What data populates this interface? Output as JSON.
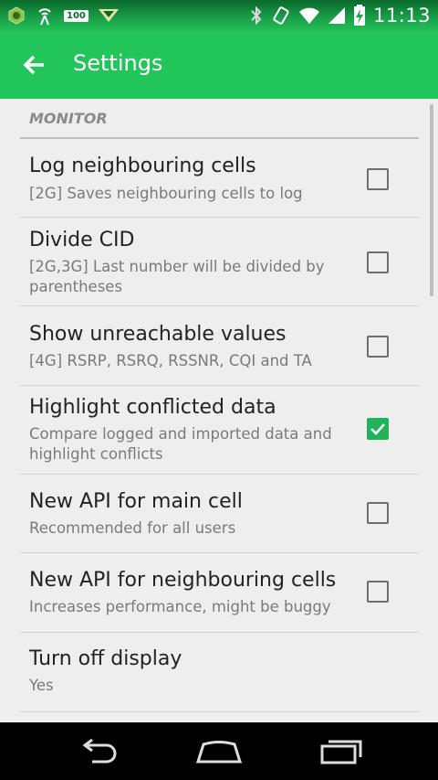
{
  "status_bar": {
    "battery_badge": "100",
    "time": "11:13"
  },
  "action_bar": {
    "title": "Settings"
  },
  "category": {
    "label": "MONITOR"
  },
  "preferences": [
    {
      "title": "Log neighbouring cells",
      "summary": "[2G] Saves neighbouring cells to log",
      "checked": false
    },
    {
      "title": "Divide CID",
      "summary": "[2G,3G] Last number will be divided by parentheses",
      "checked": false
    },
    {
      "title": "Show unreachable values",
      "summary": "[4G] RSRP, RSRQ, RSSNR, CQI and TA",
      "checked": false
    },
    {
      "title": "Highlight conflicted data",
      "summary": "Compare logged and imported data and highlight conflicts",
      "checked": true
    },
    {
      "title": "New API for main cell",
      "summary": "Recommended for all users",
      "checked": false
    },
    {
      "title": "New API for neighbouring cells",
      "summary": "Increases performance, might be buggy",
      "checked": false
    },
    {
      "title": "Turn off display",
      "summary": "Yes"
    }
  ],
  "colors": {
    "accent": "#22c55a",
    "checked": "#21b35a"
  }
}
